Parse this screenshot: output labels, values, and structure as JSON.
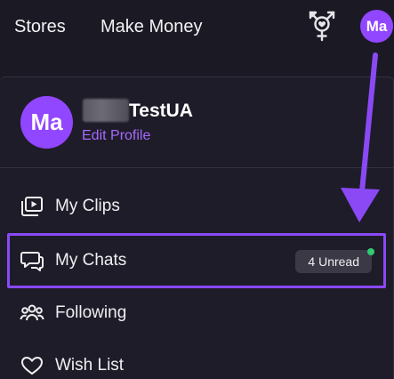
{
  "nav": {
    "stores": "Stores",
    "make_money": "Make Money",
    "gender_icon": "transgender-symbol-icon",
    "avatar_initials": "Ma"
  },
  "profile": {
    "avatar_initials": "Ma",
    "username": "TestUA",
    "edit_label": "Edit Profile"
  },
  "menu": {
    "items": [
      {
        "label": "My Clips",
        "icon": "clips-icon"
      },
      {
        "label": "My Chats",
        "icon": "chat-bubbles-icon",
        "badge": "4 Unread",
        "highlighted": true
      },
      {
        "label": "Following",
        "icon": "people-icon"
      },
      {
        "label": "Wish List",
        "icon": "heart-icon"
      }
    ]
  },
  "colors": {
    "accent": "#9146ff",
    "highlight_border": "#8a49f5",
    "arrow": "#8a49f5",
    "unread_dot": "#2fcc71",
    "background": "#1b1924"
  }
}
